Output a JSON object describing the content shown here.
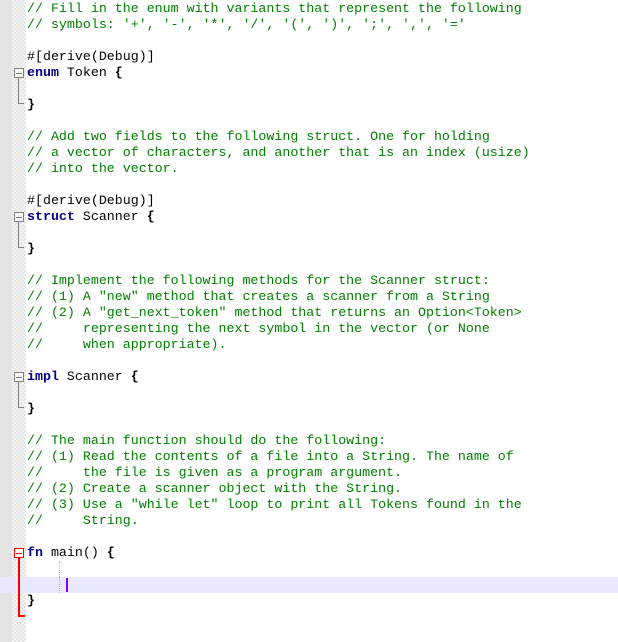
{
  "editor": {
    "language": "rust",
    "colors": {
      "comment": "#008000",
      "keyword": "#00008b",
      "current_line": "#e8e8ff",
      "caret": "#8000ff",
      "active_fold": "#ff0000"
    },
    "lines": [
      {
        "comment": "// Fill in the enum with variants that represent the following"
      },
      {
        "comment": "// symbols: '+', '-', '*', '/', '(', ')', ';', ',', '='"
      },
      {},
      {
        "attr": "#[derive(Debug)]"
      },
      {
        "kw": "enum",
        "name": " Token ",
        "brace": "{"
      },
      {},
      {
        "brace": "}"
      },
      {},
      {
        "comment": "// Add two fields to the following struct. One for holding"
      },
      {
        "comment": "// a vector of characters, and another that is an index (usize)"
      },
      {
        "comment": "// into the vector."
      },
      {},
      {
        "attr": "#[derive(Debug)]"
      },
      {
        "kw": "struct",
        "name": " Scanner ",
        "brace": "{"
      },
      {},
      {
        "brace": "}"
      },
      {},
      {
        "comment": "// Implement the following methods for the Scanner struct:"
      },
      {
        "comment": "// (1) A \"new\" method that creates a scanner from a String"
      },
      {
        "comment": "// (2) A \"get_next_token\" method that returns an Option<Token>"
      },
      {
        "comment": "//     representing the next symbol in the vector (or None"
      },
      {
        "comment": "//     when appropriate)."
      },
      {},
      {
        "kw": "impl",
        "name": " Scanner ",
        "brace": "{"
      },
      {},
      {
        "brace": "}"
      },
      {},
      {
        "comment": "// The main function should do the following:"
      },
      {
        "comment": "// (1) Read the contents of a file into a String. The name of"
      },
      {
        "comment": "//     the file is given as a program argument."
      },
      {
        "comment": "// (2) Create a scanner object with the String."
      },
      {
        "comment": "// (3) Use a \"while let\" loop to print all Tokens found in the"
      },
      {
        "comment": "//     String."
      },
      {},
      {
        "kw": "fn",
        "name": " main() ",
        "brace": "{"
      },
      {},
      {
        "current": true
      },
      {
        "brace": "}"
      }
    ]
  }
}
